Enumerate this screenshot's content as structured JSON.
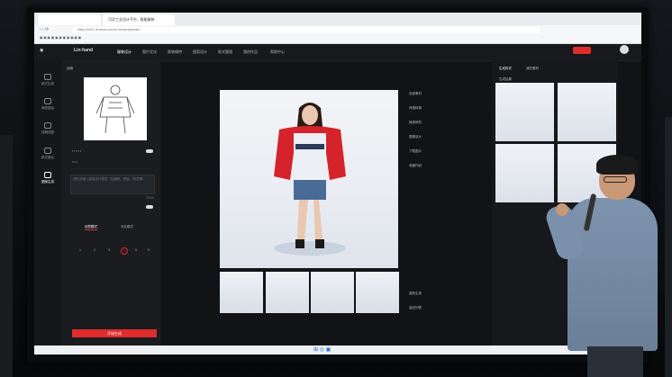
{
  "browser": {
    "tabs": [
      "",
      "可灵工业设计平台 - 智能服装",
      ""
    ],
    "url": "https://AIGC.lenhand.com/ai-industry/fashion"
  },
  "app": {
    "logo_text": "Lin·hand",
    "nav": [
      "服装设计",
      "图片优化",
      "换装模特",
      "图案设计",
      "款式管理",
      "我的作品",
      "帮助中心"
    ]
  },
  "left_rail": [
    "款式生成",
    "局部重绘",
    "线稿成图",
    "款式融合",
    "图案生成"
  ],
  "left_panel": {
    "section_title": "线稿",
    "prompt_placeholder": "请在此输入服装设计描述（如面料、颜色、款式等）",
    "prompt_counter": "0/500",
    "seg": [
      "创意模式",
      "写实模式"
    ],
    "steps": [
      "1",
      "2",
      "3",
      "4",
      "5",
      "6"
    ],
    "generate_label": "开始生成"
  },
  "side_tools": [
    "全部素材",
    "风格转换",
    "局部修改",
    "图像放大",
    "下载图片",
    "收藏作品"
  ],
  "bottom_tools": [
    "重新生成",
    "返回列表"
  ],
  "right_panel": {
    "tabs": [
      "生成历史",
      "我的素材"
    ],
    "label": "生成结果"
  },
  "colors": {
    "accent": "#e02c2c",
    "bg": "#111316"
  }
}
